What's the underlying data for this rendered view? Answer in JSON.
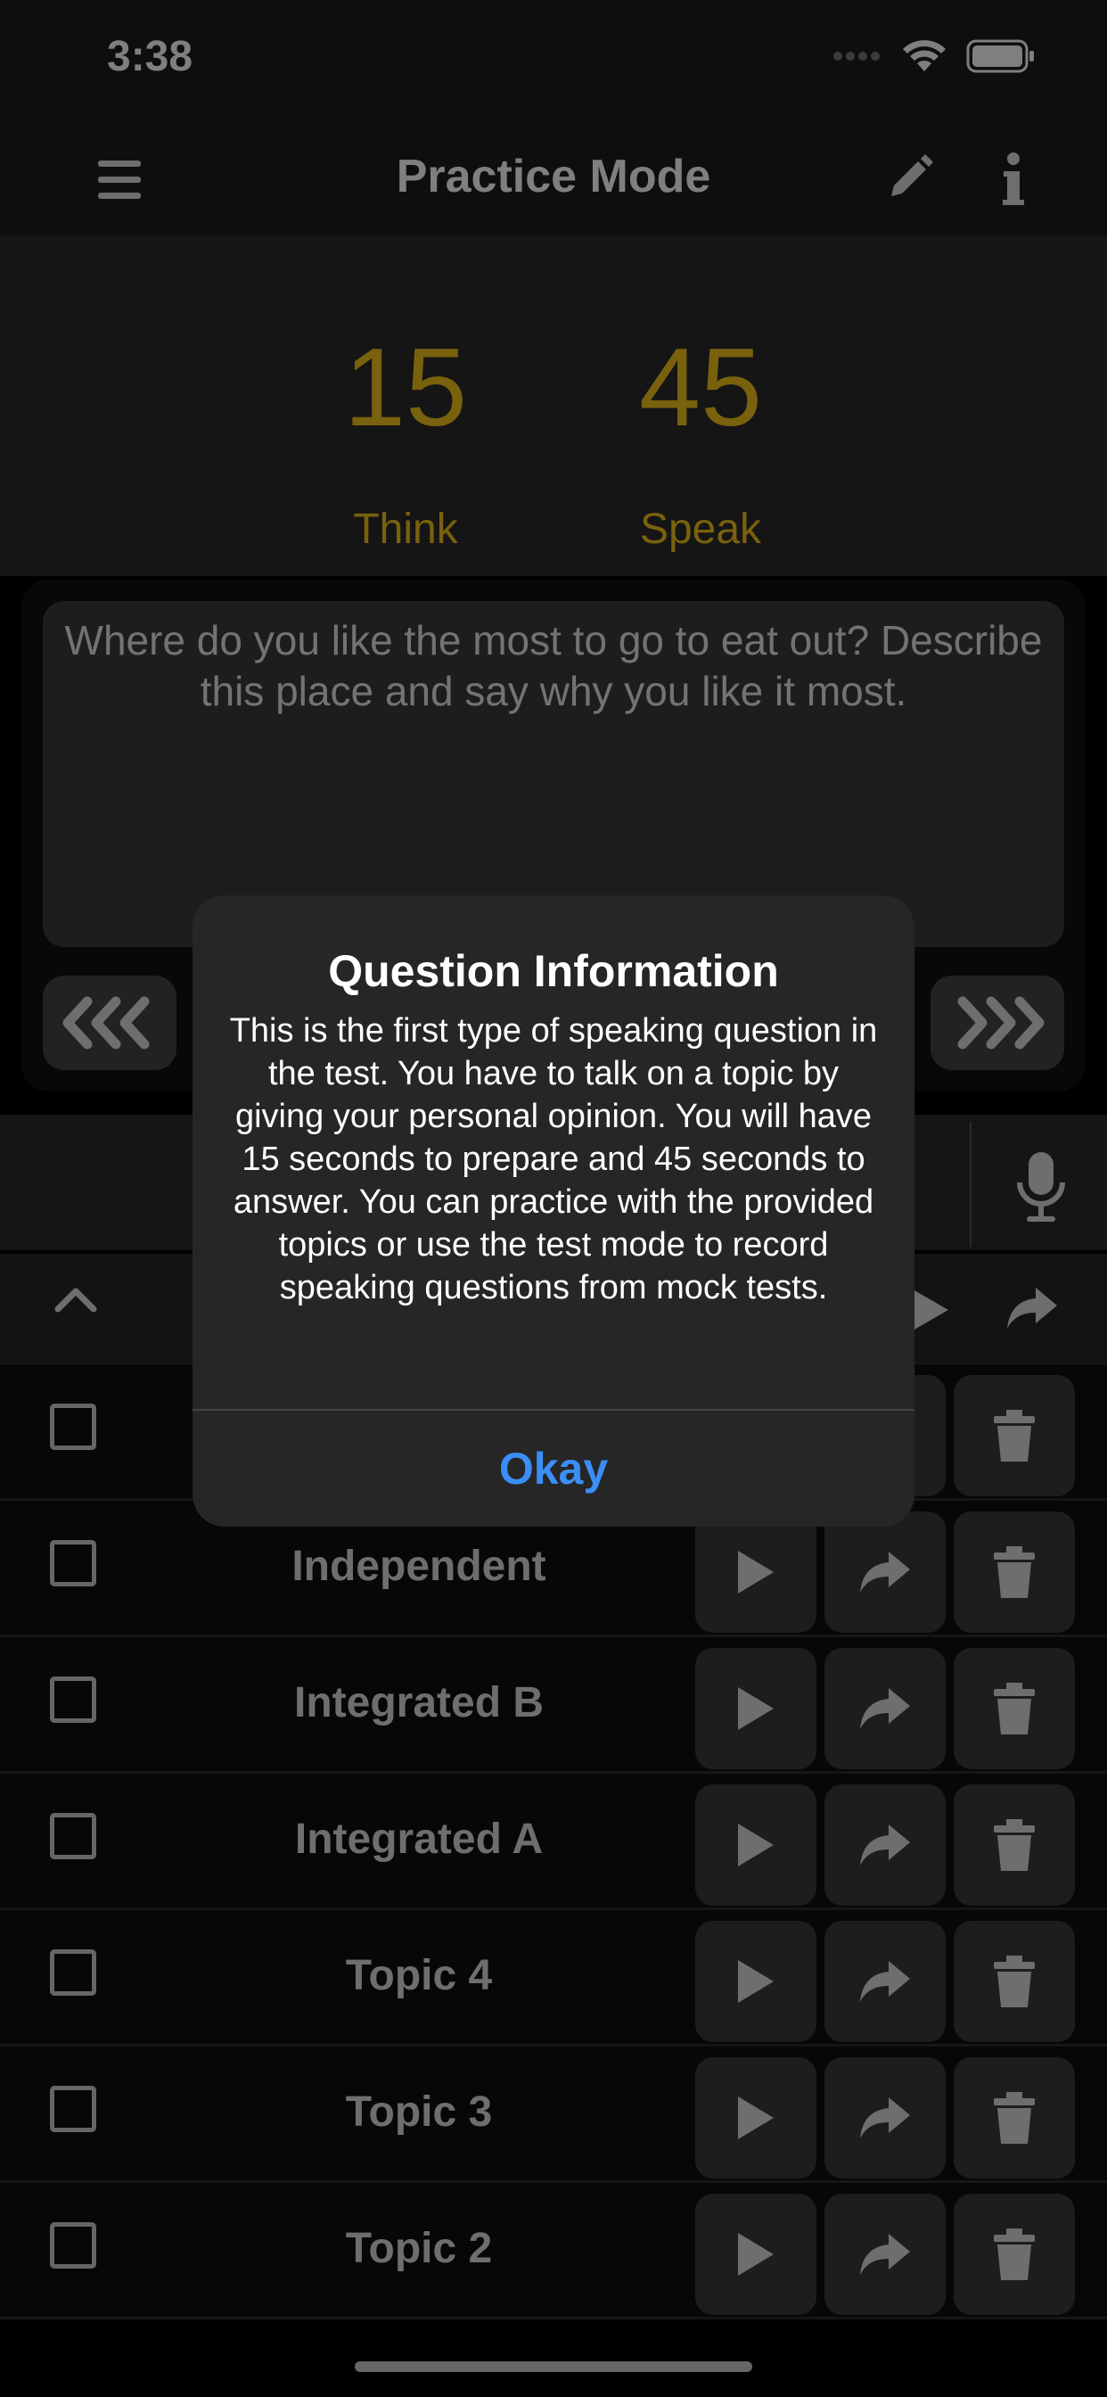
{
  "status_bar": {
    "time": "3:38"
  },
  "nav": {
    "title": "Practice Mode"
  },
  "timers": {
    "think_value": "15",
    "speak_value": "45",
    "think_label": "Think",
    "speak_label": "Speak"
  },
  "question": {
    "text": "Where do you like the most to go to eat out? Describe this place and say why you like it most."
  },
  "recordings": [
    {
      "label": ""
    },
    {
      "label": "Independent"
    },
    {
      "label": "Integrated B"
    },
    {
      "label": "Integrated A"
    },
    {
      "label": "Topic 4"
    },
    {
      "label": "Topic 3"
    },
    {
      "label": "Topic 2"
    }
  ],
  "alert": {
    "title": "Question Information",
    "message": "This is the first type of speaking question in the test. You have to talk on a topic by giving your personal opinion. You will have 15 seconds to prepare and 45 seconds to answer. You can practice with the provided topics or use the test mode to record speaking questions from mock tests.",
    "button": "Okay"
  },
  "colors": {
    "accent": "#f2c21b",
    "alert_button": "#3b8ef6"
  }
}
